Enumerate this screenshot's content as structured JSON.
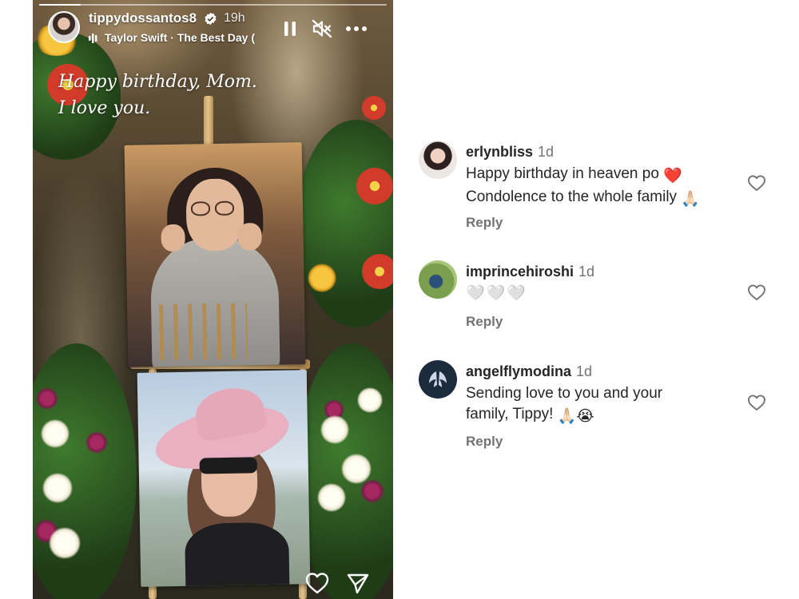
{
  "story": {
    "username": "tippydossantos8",
    "time": "19h",
    "music": {
      "artist": "Taylor Swift",
      "separator": " · ",
      "song": "The Best Day ("
    },
    "caption_line1": "Happy birthday, Mom.",
    "caption_line2": "I love you.",
    "progress": 0.12,
    "icons": {
      "verified": "verified-badge-icon",
      "music": "music-bars-icon",
      "pause": "pause-icon",
      "mute": "muted-speaker-icon",
      "more": "more-options-icon",
      "like": "heart-outline-icon",
      "share": "paper-plane-icon"
    }
  },
  "comments": [
    {
      "username": "erlynbliss",
      "time": "1d",
      "line1": "Happy birthday in heaven po",
      "line1_emoji": "❤️",
      "line2": "Condolence to the whole family",
      "line2_emoji": "🙏🏻",
      "reply": "Reply"
    },
    {
      "username": "imprincehiroshi",
      "time": "1d",
      "line1": "🤍🤍🤍",
      "reply": "Reply"
    },
    {
      "username": "angelflymodina",
      "time": "1d",
      "line1": "Sending love to you and your",
      "line2": "family, Tippy!",
      "line2_emoji": "🙏🏻😭",
      "reply": "Reply"
    }
  ],
  "colors": {
    "heart_red": "#e0243f",
    "text_primary": "#262626",
    "text_secondary": "#737373"
  }
}
